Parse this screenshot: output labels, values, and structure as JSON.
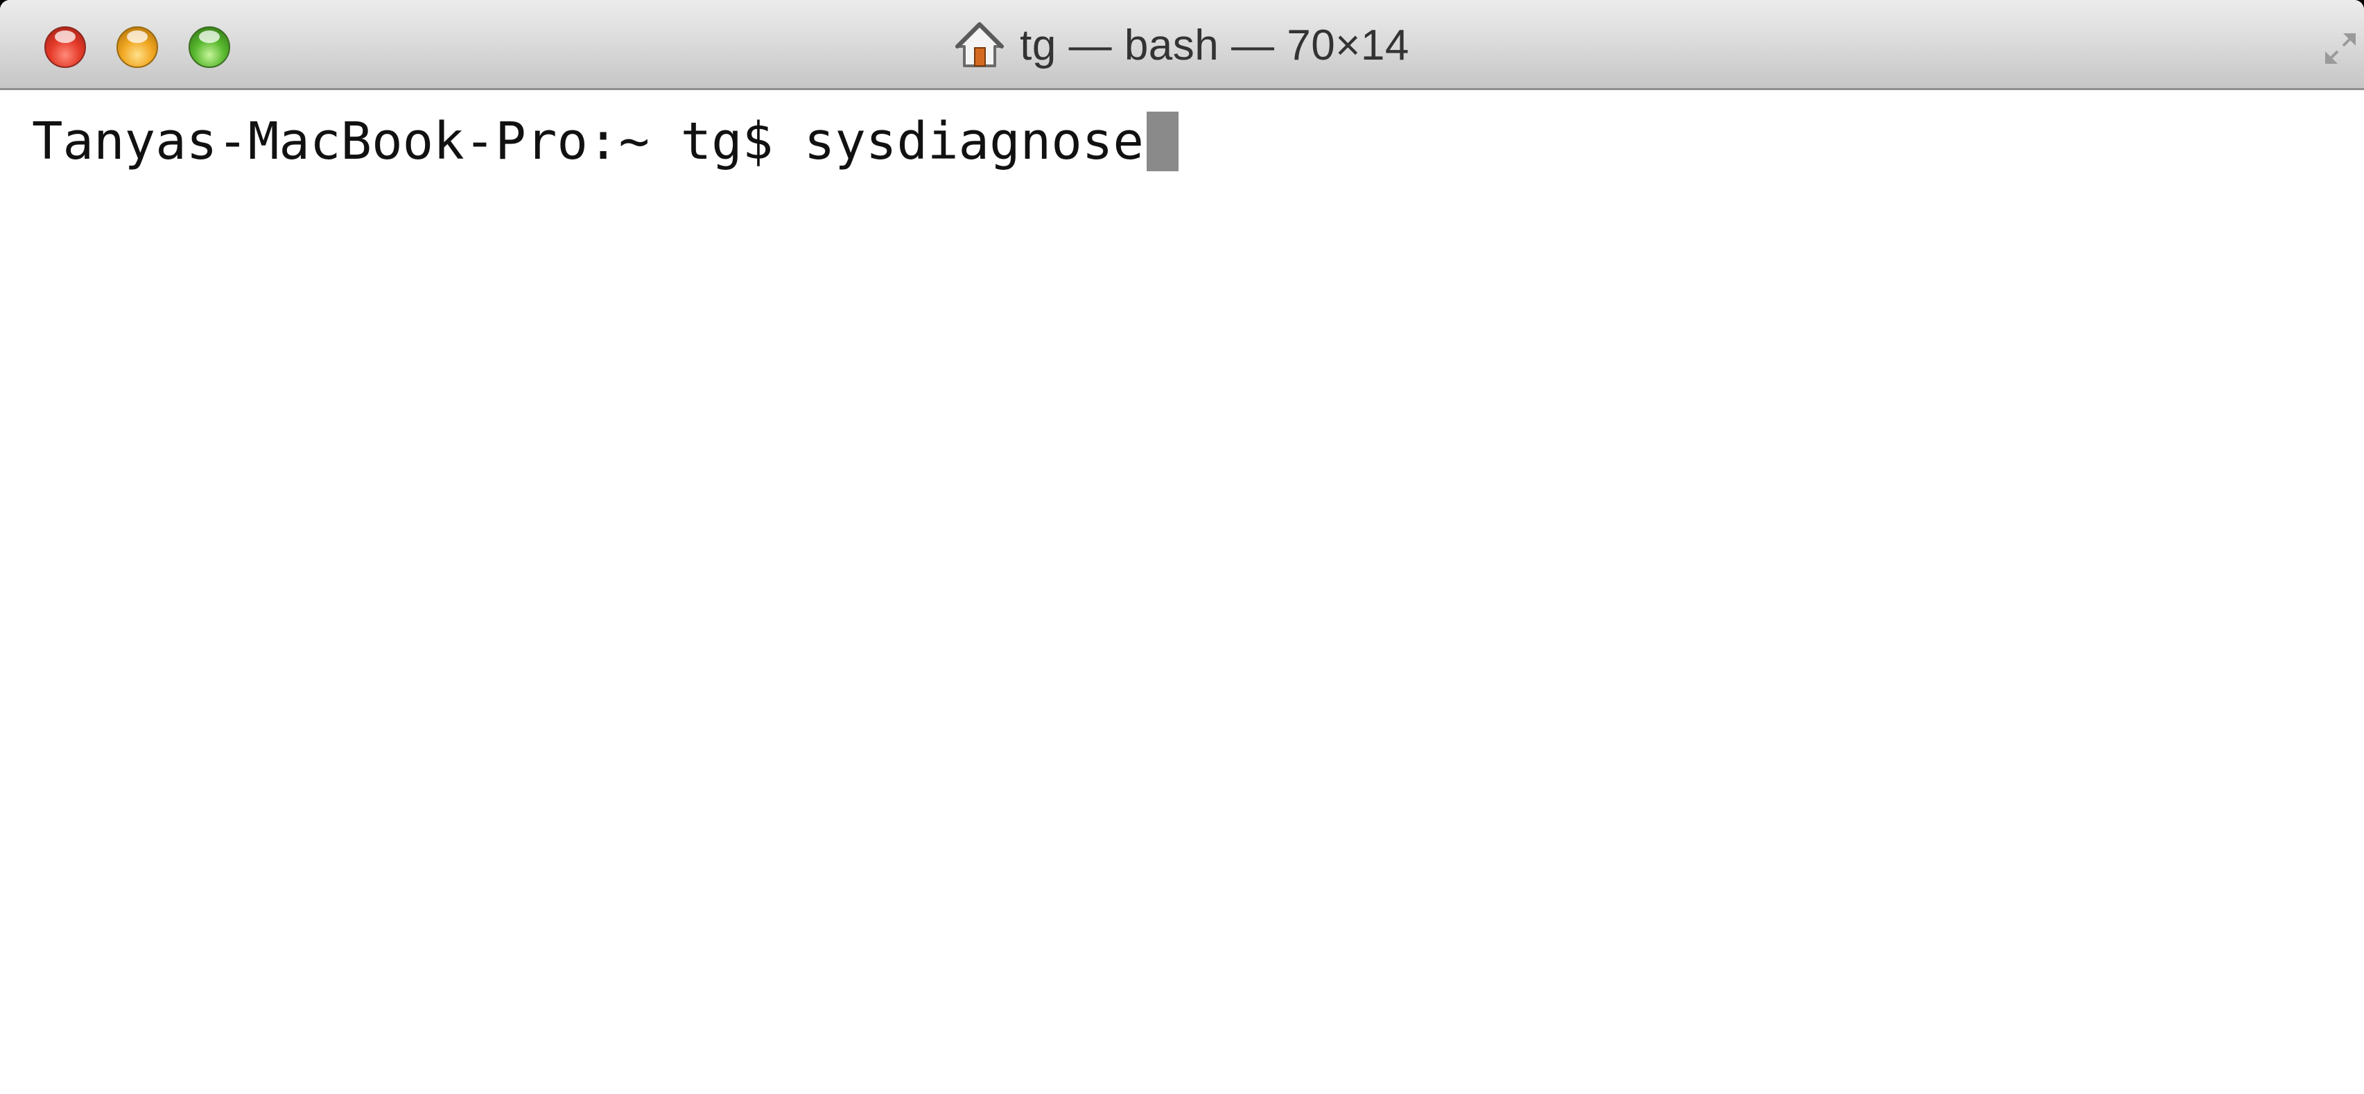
{
  "window": {
    "title": "tg — bash — 70×14",
    "title_icon": "home-icon",
    "controls": {
      "close_color": "#e53b2a",
      "minimize_color": "#f1a722",
      "zoom_color": "#58b82e"
    },
    "fullscreen_icon": "fullscreen-arrows-icon"
  },
  "terminal": {
    "prompt": "Tanyas-MacBook-Pro:~ tg$ ",
    "command": "sysdiagnose",
    "cursor_color": "#8a8a8a",
    "background": "#ffffff",
    "text_color": "#111111"
  }
}
